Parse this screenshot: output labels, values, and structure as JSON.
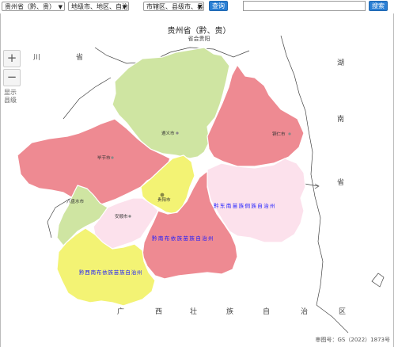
{
  "toolbar": {
    "province_select": "贵州省（黔、贵）",
    "city_select": "地级市、地区、自治州、盟",
    "county_select": "市辖区、县级市、县",
    "query_button": "查询",
    "search_value": "",
    "search_button": "搜索"
  },
  "map": {
    "title": "贵州省（黔、贵）",
    "subtitle": "省会贵阳",
    "zoom_in": "+",
    "zoom_out": "−",
    "show_county": "显示县级",
    "neighbors": {
      "sichuan_1": "川",
      "sichuan_2": "省",
      "hunan_1": "湖",
      "hunan_2": "南",
      "hunan_3": "省",
      "guangxi": [
        "广",
        "西",
        "壮",
        "族",
        "自",
        "治",
        "区"
      ]
    },
    "cities": {
      "zunyi": "遵义市",
      "tongren": "铜仁市",
      "bijie": "毕节市",
      "guiyang": "贵阳市",
      "liupanshui": "六盘水市",
      "anshun": "安顺市",
      "qiandongnan": "黔东南苗族侗族自治州",
      "qiannan": "黔南布依族苗族自治州",
      "qianxinan": "黔西南布依族苗族自治州"
    },
    "footer": "审图号：GS（2022）1873号"
  },
  "colors": {
    "red": "#ee8a92",
    "green": "#cfe5a2",
    "yellow": "#f3f374",
    "pink": "#fce1ec",
    "label_blue": "#1a1aff",
    "button_blue": "#2a7fd4"
  }
}
